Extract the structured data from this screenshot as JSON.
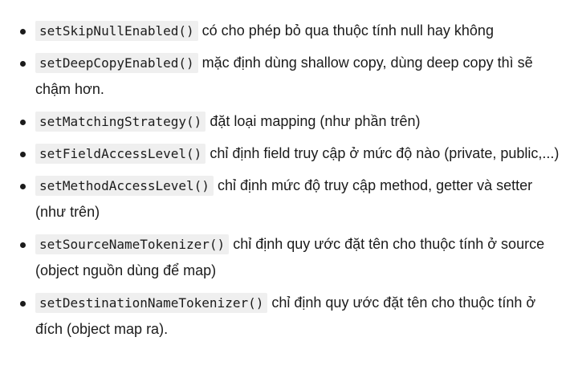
{
  "items": [
    {
      "code": "setSkipNullEnabled()",
      "text": "có cho phép bỏ qua thuộc tính null hay không"
    },
    {
      "code": "setDeepCopyEnabled()",
      "text": "mặc định dùng shallow copy, dùng deep copy thì sẽ chậm hơn."
    },
    {
      "code": "setMatchingStrategy()",
      "text": "đặt loại mapping (như phần trên)"
    },
    {
      "code": "setFieldAccessLevel()",
      "text": "chỉ định field truy cập ở mức độ nào (private, public,...)"
    },
    {
      "code": "setMethodAccessLevel()",
      "text": "chỉ định mức độ truy cập method, getter và setter (như trên)"
    },
    {
      "code": "setSourceNameTokenizer()",
      "text": "chỉ định quy ước đặt tên cho thuộc tính ở source (object nguồn dùng để map)"
    },
    {
      "code": "setDestinationNameTokenizer()",
      "text": "chỉ định quy ước đặt tên cho thuộc tính ở đích (object map ra)."
    }
  ]
}
